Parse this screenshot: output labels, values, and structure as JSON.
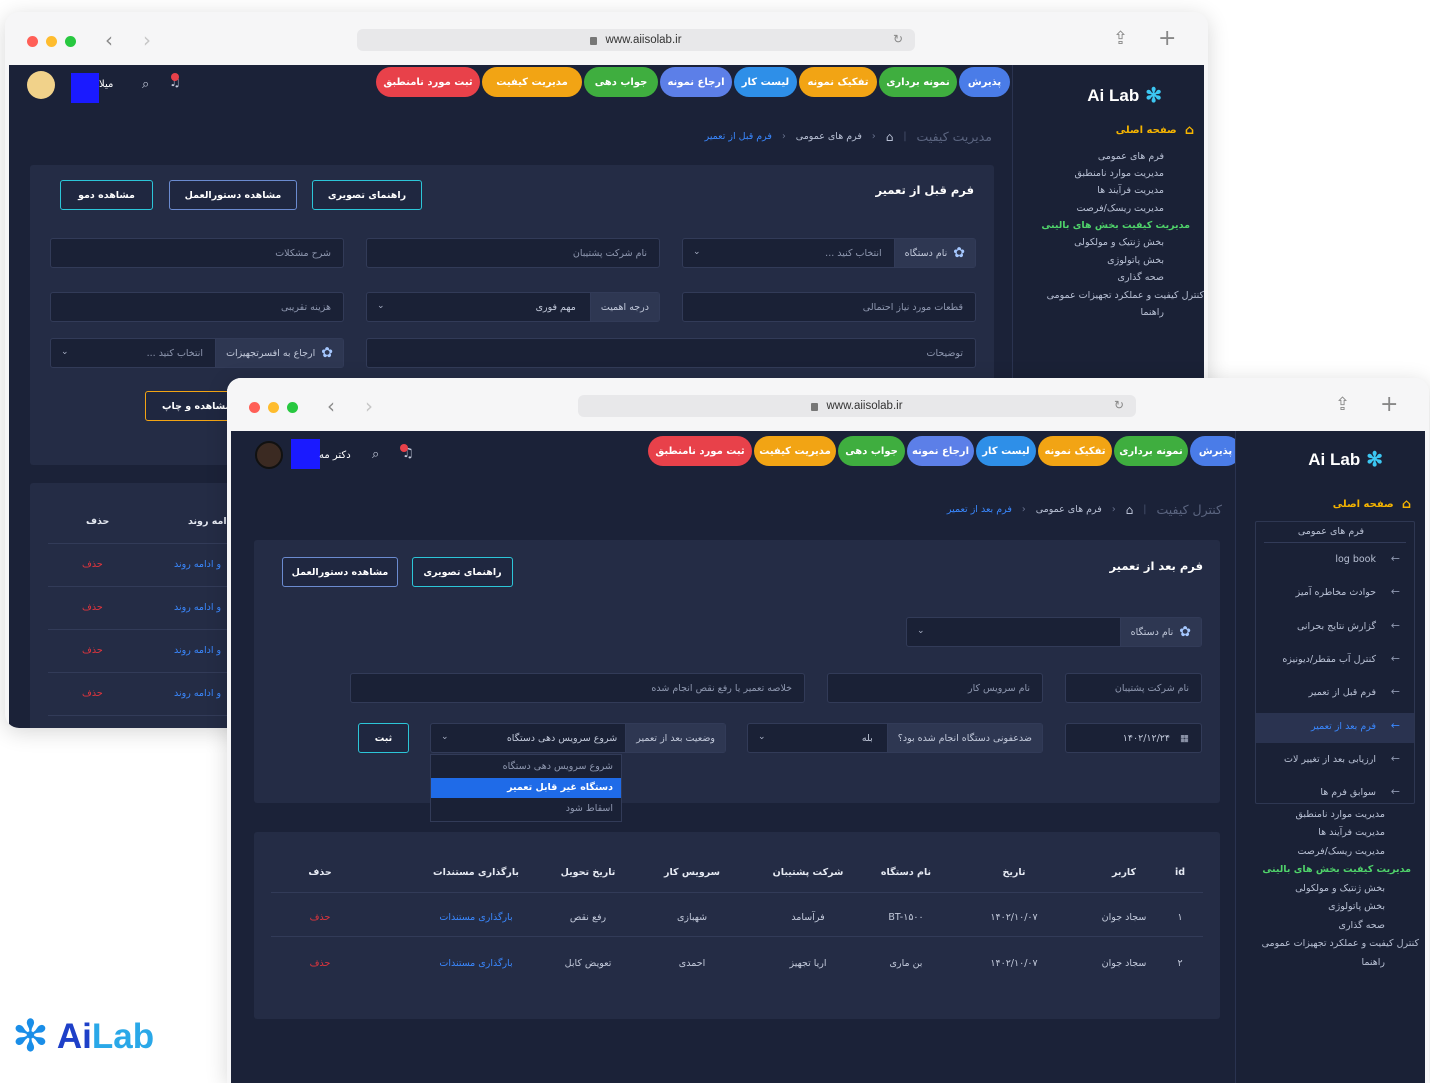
{
  "browser": {
    "url": "www.aiisolab.ir"
  },
  "colors": {
    "app_bg": "#1b2238",
    "panel": "#242c45",
    "accent_blue": "#3a88ff",
    "accent_green": "#4fd36a",
    "home_yellow": "#f5b400",
    "delete_red": "#e0353d"
  },
  "modules": [
    {
      "label": "پذیرش",
      "color": "#4a7ce8"
    },
    {
      "label": "نمونه برداری",
      "color": "#3fae3f"
    },
    {
      "label": "تفکیک نمونه",
      "color": "#f2a414"
    },
    {
      "label": "لیست کار",
      "color": "#2e8fe8"
    },
    {
      "label": "ارجاع نمونه",
      "color": "#5c7fe8"
    },
    {
      "label": "جواب دهی",
      "color": "#3fae3f"
    },
    {
      "label": "مدیریت کیفیت",
      "color": "#f2a414"
    },
    {
      "label": "ثبت مورد نامنطبق",
      "color": "#e8414a"
    }
  ],
  "logo": {
    "ai": "Ai",
    "lab": "Lab"
  },
  "back": {
    "user": "میلا",
    "sidebar": {
      "home": "صفحه اصلی",
      "items": [
        "فرم های عمومی",
        "مدیریت موارد نامنطبق",
        "مدیریت فرآیند ها",
        "مدیریت ریسک/فرصت",
        "مدیریت کیفیت بخش های بالینی",
        "بخش ژنتیک و مولکولی",
        "بخش پاتولوژی",
        "صحه گذاری",
        "کنترل کیفیت و عملکرد تجهیزات عمومی",
        "راهنما"
      ]
    },
    "breadcrumb": {
      "title": "مدیریت کیفیت",
      "section": "فرم های عمومی",
      "current": "فرم قبل از تعمیر"
    },
    "form_title": "فرم قبل از تعمیر",
    "buttons": {
      "guide": "راهنمای تصویری",
      "manual": "مشاهده دستورالعمل",
      "demo": "مشاهده دمو",
      "print": "مشاهده و چاپ"
    },
    "fields": {
      "device_label": "نام دستگاه",
      "device_placeholder": "انتخاب کنید ...",
      "support": "نام شرکت پشتیبان",
      "problem": "شرح مشکلات",
      "parts": "قطعات مورد نیاز احتمالی",
      "priority_label": "درجه اهمیت",
      "priority_value": "مهم فوری",
      "cost": "هزینه تقریبی",
      "notes": "توضیحات",
      "refer_label": "ارجاع به افسرتجهیزات",
      "refer_placeholder": "انتخاب کنید ..."
    },
    "table": {
      "delete_header": "حذف",
      "continue_header": "ادامه روند",
      "rows": [
        {
          "continue": "و ادامه روند",
          "delete": "حذف"
        },
        {
          "continue": "و ادامه روند",
          "delete": "حذف"
        },
        {
          "continue": "و ادامه روند",
          "delete": "حذف"
        },
        {
          "continue": "و ادامه روند",
          "delete": "حذف"
        }
      ]
    }
  },
  "front": {
    "user": "دکتر مه",
    "sidebar": {
      "home": "صفحه اصلی",
      "group_title": "فرم های عمومی",
      "sub_items": [
        "log book",
        "حوادث مخاطره آمیز",
        "گزارش نتایج بحرانی",
        "کنترل آب مقطر/دیونیزه",
        "فرم قبل از تعمیر",
        "فرم بعد از تعمیر",
        "ارزیابی بعد از تغییر لات",
        "سوابق فرم ها"
      ],
      "items": [
        "مدیریت موارد نامنطبق",
        "مدیریت فرآیند ها",
        "مدیریت ریسک/فرصت",
        "مدیریت کیفیت بخش های بالینی",
        "بخش ژنتیک و مولکولی",
        "بخش پاتولوژی",
        "صحه گذاری",
        "کنترل کیفیت و عملکرد تجهیزات عمومی",
        "راهنما"
      ]
    },
    "breadcrumb": {
      "title": "کنترل کیفیت",
      "section": "فرم های عمومی",
      "current": "فرم بعد از تعمیر"
    },
    "form_title": "فرم بعد از تعمیر",
    "buttons": {
      "guide": "راهنمای تصویری",
      "manual": "مشاهده دستورالعمل",
      "submit": "ثبت"
    },
    "fields": {
      "device_label": "نام دستگاه",
      "support": "نام شرکت پشتیبان",
      "service": "نام سرویس کار",
      "summary": "خلاصه تعمیر یا رفع نقص انجام شده",
      "date": "۱۴۰۲/۱۲/۲۴",
      "disinfect_label": "ضدعفونی دستگاه انجام شده بود؟",
      "disinfect_value": "بله",
      "status_label": "وضعیت بعد از تعمیر",
      "status_value": "شروع سرویس دهی دستگاه"
    },
    "dropdown_options": [
      "شروع سرویس دهی دستگاه",
      "دستگاه غیر قابل تعمیر",
      "اسقاط شود"
    ],
    "table": {
      "headers": [
        "id",
        "کاربر",
        "تاریخ",
        "نام دستگاه",
        "شرکت پشتیبان",
        "سرویس کار",
        "تاریخ تحویل",
        "بارگذاری مستندات",
        "حذف"
      ],
      "rows": [
        [
          "۱",
          "سجاد جوان",
          "۱۴۰۲/۱۰/۰۷",
          "BT-۱۵۰۰",
          "فرآسامد",
          "شهبازی",
          "رفع نقص",
          "بارگذاری مستندات",
          "حذف"
        ],
        [
          "۲",
          "سجاد جوان",
          "۱۴۰۲/۱۰/۰۷",
          "بن ماری",
          "اریا تجهیز",
          "احمدی",
          "تعویض کابل",
          "بارگذاری مستندات",
          "حذف"
        ]
      ]
    }
  },
  "brand_logo": {
    "ai": "Ai",
    "lab": "Lab"
  }
}
